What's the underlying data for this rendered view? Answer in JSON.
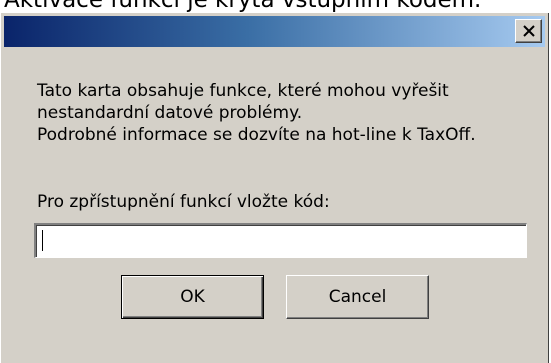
{
  "caption": "Aktivace funkcí je krytá vstupním kódem.",
  "dialog": {
    "title": "",
    "close_icon": "close-icon",
    "message": [
      "Tato karta obsahuje funkce, které mohou vyřešit",
      "nestandardní datové problémy.",
      "Podrobné informace se dozvíte na hot-line k TaxOff."
    ],
    "prompt_label": "Pro zpřístupnění funkcí vložte kód:",
    "code_value": "",
    "ok_label": "OK",
    "cancel_label": "Cancel"
  },
  "colors": {
    "face": "#d4d0c8",
    "title_start": "#0a246a",
    "title_end": "#a6caf0"
  }
}
